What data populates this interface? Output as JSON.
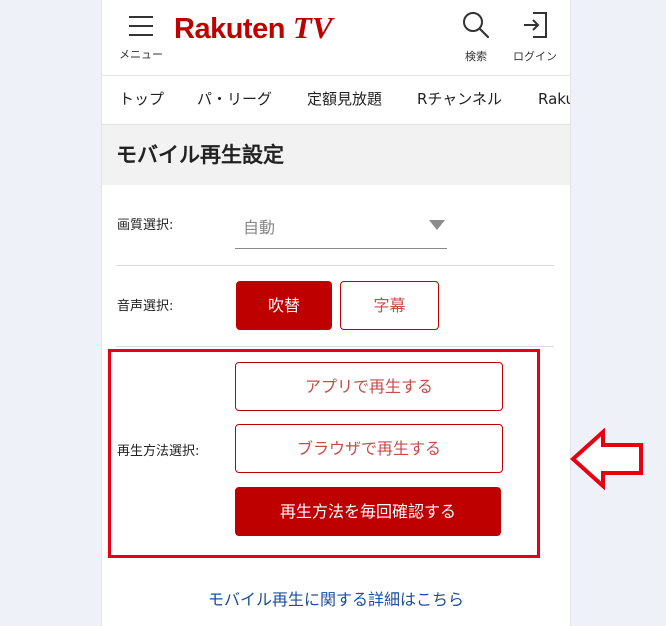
{
  "header": {
    "menu_label": "メニュー",
    "logo_text": "Rakuten",
    "logo_tv": "TV",
    "search_label": "検索",
    "login_label": "ログイン"
  },
  "nav": {
    "items": [
      "トップ",
      "パ・リーグ",
      "定額見放題",
      "Rチャンネル",
      "Raku"
    ]
  },
  "page": {
    "title": "モバイル再生設定"
  },
  "settings": {
    "quality": {
      "label": "画質選択:",
      "selected": "自動"
    },
    "audio": {
      "label": "音声選択:",
      "options": [
        "吹替",
        "字幕"
      ],
      "selected": "吹替"
    },
    "playback": {
      "label": "再生方法選択:",
      "options": [
        "アプリで再生する",
        "ブラウザで再生する",
        "再生方法を毎回確認する"
      ],
      "selected": "再生方法を毎回確認する"
    }
  },
  "footer_link": "モバイル再生に関する詳細はこちら",
  "colors": {
    "brand": "#bf0000",
    "highlight": "#e60012",
    "link": "#1d4fa0"
  },
  "icons": [
    "hamburger-icon",
    "search-icon",
    "login-icon",
    "chevron-down-icon",
    "arrow-left-outline-icon"
  ]
}
